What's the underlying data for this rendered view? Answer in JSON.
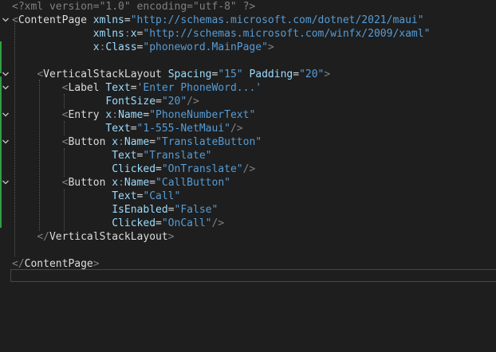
{
  "editor": {
    "file_language": "xaml",
    "colors": {
      "background": "#1e1e1e",
      "tag": "#dcdcdc",
      "attribute": "#9cdcfe",
      "string": "#569cd6",
      "punctuation": "#808080",
      "change_bar": "#2ea043"
    },
    "lines": [
      {
        "tokens": [
          [
            "pi",
            "<?xml version=\"1.0\" encoding=\"utf-8\" ?>"
          ]
        ]
      },
      {
        "tokens": [
          [
            "br",
            "<"
          ],
          [
            "tag",
            "ContentPage"
          ],
          [
            "sp",
            " "
          ],
          [
            "attr",
            "xmlns"
          ],
          [
            "eq",
            "="
          ],
          [
            "str",
            "\"http://schemas.microsoft.com/dotnet/2021/maui\""
          ]
        ]
      },
      {
        "tokens": [
          [
            "sp",
            "             "
          ],
          [
            "attr",
            "xmlns"
          ],
          [
            "br",
            ":"
          ],
          [
            "attr",
            "x"
          ],
          [
            "eq",
            "="
          ],
          [
            "str",
            "\"http://schemas.microsoft.com/winfx/2009/xaml\""
          ]
        ]
      },
      {
        "tokens": [
          [
            "sp",
            "             "
          ],
          [
            "attr",
            "x"
          ],
          [
            "br",
            ":"
          ],
          [
            "attr",
            "Class"
          ],
          [
            "eq",
            "="
          ],
          [
            "str",
            "\"phoneword.MainPage\""
          ],
          [
            "br",
            ">"
          ]
        ]
      },
      {
        "tokens": []
      },
      {
        "tokens": [
          [
            "sp",
            "    "
          ],
          [
            "br",
            "<"
          ],
          [
            "tag",
            "VerticalStackLayout"
          ],
          [
            "sp",
            " "
          ],
          [
            "attr",
            "Spacing"
          ],
          [
            "eq",
            "="
          ],
          [
            "str",
            "\"15\""
          ],
          [
            "sp",
            " "
          ],
          [
            "attr",
            "Padding"
          ],
          [
            "eq",
            "="
          ],
          [
            "str",
            "\"20\""
          ],
          [
            "br",
            ">"
          ]
        ]
      },
      {
        "tokens": [
          [
            "sp",
            "        "
          ],
          [
            "br",
            "<"
          ],
          [
            "tag",
            "Label"
          ],
          [
            "sp",
            " "
          ],
          [
            "attr",
            "Text"
          ],
          [
            "eq",
            "="
          ],
          [
            "str",
            "'Enter PhoneWord...'"
          ]
        ]
      },
      {
        "tokens": [
          [
            "sp",
            "               "
          ],
          [
            "attr",
            "FontSize"
          ],
          [
            "eq",
            "="
          ],
          [
            "str",
            "\"20\""
          ],
          [
            "br",
            "/>"
          ]
        ]
      },
      {
        "tokens": [
          [
            "sp",
            "        "
          ],
          [
            "br",
            "<"
          ],
          [
            "tag",
            "Entry"
          ],
          [
            "sp",
            " "
          ],
          [
            "attr",
            "x"
          ],
          [
            "br",
            ":"
          ],
          [
            "attr",
            "Name"
          ],
          [
            "eq",
            "="
          ],
          [
            "str",
            "\"PhoneNumberText\""
          ]
        ]
      },
      {
        "tokens": [
          [
            "sp",
            "               "
          ],
          [
            "attr",
            "Text"
          ],
          [
            "eq",
            "="
          ],
          [
            "str",
            "\"1-555-NetMaui\""
          ],
          [
            "br",
            "/>"
          ]
        ]
      },
      {
        "tokens": [
          [
            "sp",
            "        "
          ],
          [
            "br",
            "<"
          ],
          [
            "tag",
            "Button"
          ],
          [
            "sp",
            " "
          ],
          [
            "attr",
            "x"
          ],
          [
            "br",
            ":"
          ],
          [
            "attr",
            "Name"
          ],
          [
            "eq",
            "="
          ],
          [
            "str",
            "\"TranslateButton\""
          ]
        ]
      },
      {
        "tokens": [
          [
            "sp",
            "                "
          ],
          [
            "attr",
            "Text"
          ],
          [
            "eq",
            "="
          ],
          [
            "str",
            "\"Translate\""
          ]
        ]
      },
      {
        "tokens": [
          [
            "sp",
            "                "
          ],
          [
            "attr",
            "Clicked"
          ],
          [
            "eq",
            "="
          ],
          [
            "str",
            "\"OnTranslate\""
          ],
          [
            "br",
            "/>"
          ]
        ]
      },
      {
        "tokens": [
          [
            "sp",
            "        "
          ],
          [
            "br",
            "<"
          ],
          [
            "tag",
            "Button"
          ],
          [
            "sp",
            " "
          ],
          [
            "attr",
            "x"
          ],
          [
            "br",
            ":"
          ],
          [
            "attr",
            "Name"
          ],
          [
            "eq",
            "="
          ],
          [
            "str",
            "\"CallButton\""
          ]
        ]
      },
      {
        "tokens": [
          [
            "sp",
            "                "
          ],
          [
            "attr",
            "Text"
          ],
          [
            "eq",
            "="
          ],
          [
            "str",
            "\"Call\""
          ]
        ]
      },
      {
        "tokens": [
          [
            "sp",
            "                "
          ],
          [
            "attr",
            "IsEnabled"
          ],
          [
            "eq",
            "="
          ],
          [
            "str",
            "\"False\""
          ]
        ]
      },
      {
        "tokens": [
          [
            "sp",
            "                "
          ],
          [
            "attr",
            "Clicked"
          ],
          [
            "eq",
            "="
          ],
          [
            "str",
            "\"OnCall\""
          ],
          [
            "br",
            "/>"
          ]
        ]
      },
      {
        "tokens": [
          [
            "sp",
            "    "
          ],
          [
            "br",
            "</"
          ],
          [
            "tag",
            "VerticalStackLayout"
          ],
          [
            "br",
            ">"
          ]
        ]
      },
      {
        "tokens": []
      },
      {
        "tokens": [
          [
            "br",
            "</"
          ],
          [
            "tag",
            "ContentPage"
          ],
          [
            "br",
            ">"
          ]
        ]
      }
    ],
    "fold_lines": [
      1,
      5,
      6,
      8,
      10,
      13
    ],
    "fold_icon": "chevron-down-icon"
  }
}
